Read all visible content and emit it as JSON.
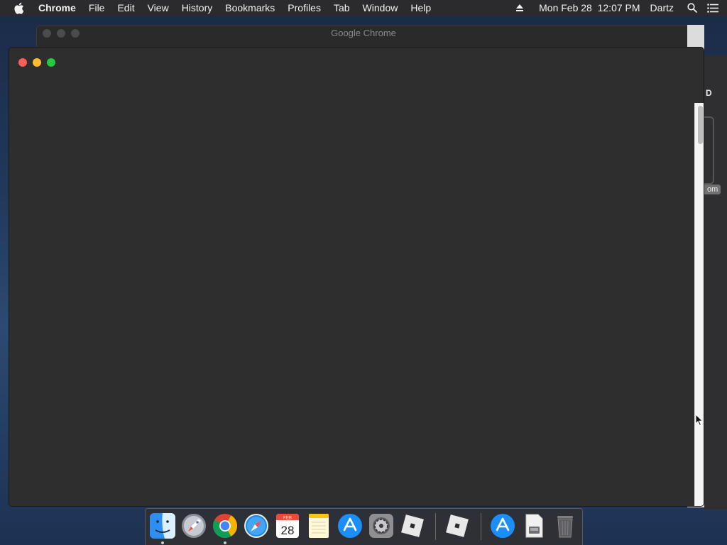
{
  "menubar": {
    "app_name": "Chrome",
    "menus": [
      "File",
      "Edit",
      "View",
      "History",
      "Bookmarks",
      "Profiles",
      "Tab",
      "Window",
      "Help"
    ],
    "datetime": "Mon Feb 28  12:07 PM",
    "user": "Dartz"
  },
  "background_window": {
    "title": "Google Chrome"
  },
  "side_peek": {
    "letter": "D",
    "pill": "om"
  },
  "dock": {
    "calendar_month": "FEB",
    "calendar_day": "28",
    "items": [
      {
        "name": "finder",
        "running": true
      },
      {
        "name": "launchpad",
        "running": false
      },
      {
        "name": "google-chrome",
        "running": true
      },
      {
        "name": "safari",
        "running": false
      },
      {
        "name": "calendar",
        "running": false
      },
      {
        "name": "notes",
        "running": false
      },
      {
        "name": "app-store",
        "running": false
      },
      {
        "name": "system-preferences",
        "running": false
      },
      {
        "name": "roblox",
        "running": false
      },
      {
        "name": "roblox-studio",
        "running": false
      },
      {
        "name": "app-store-download",
        "running": false
      },
      {
        "name": "disk-image",
        "running": false
      },
      {
        "name": "trash",
        "running": false
      }
    ]
  }
}
